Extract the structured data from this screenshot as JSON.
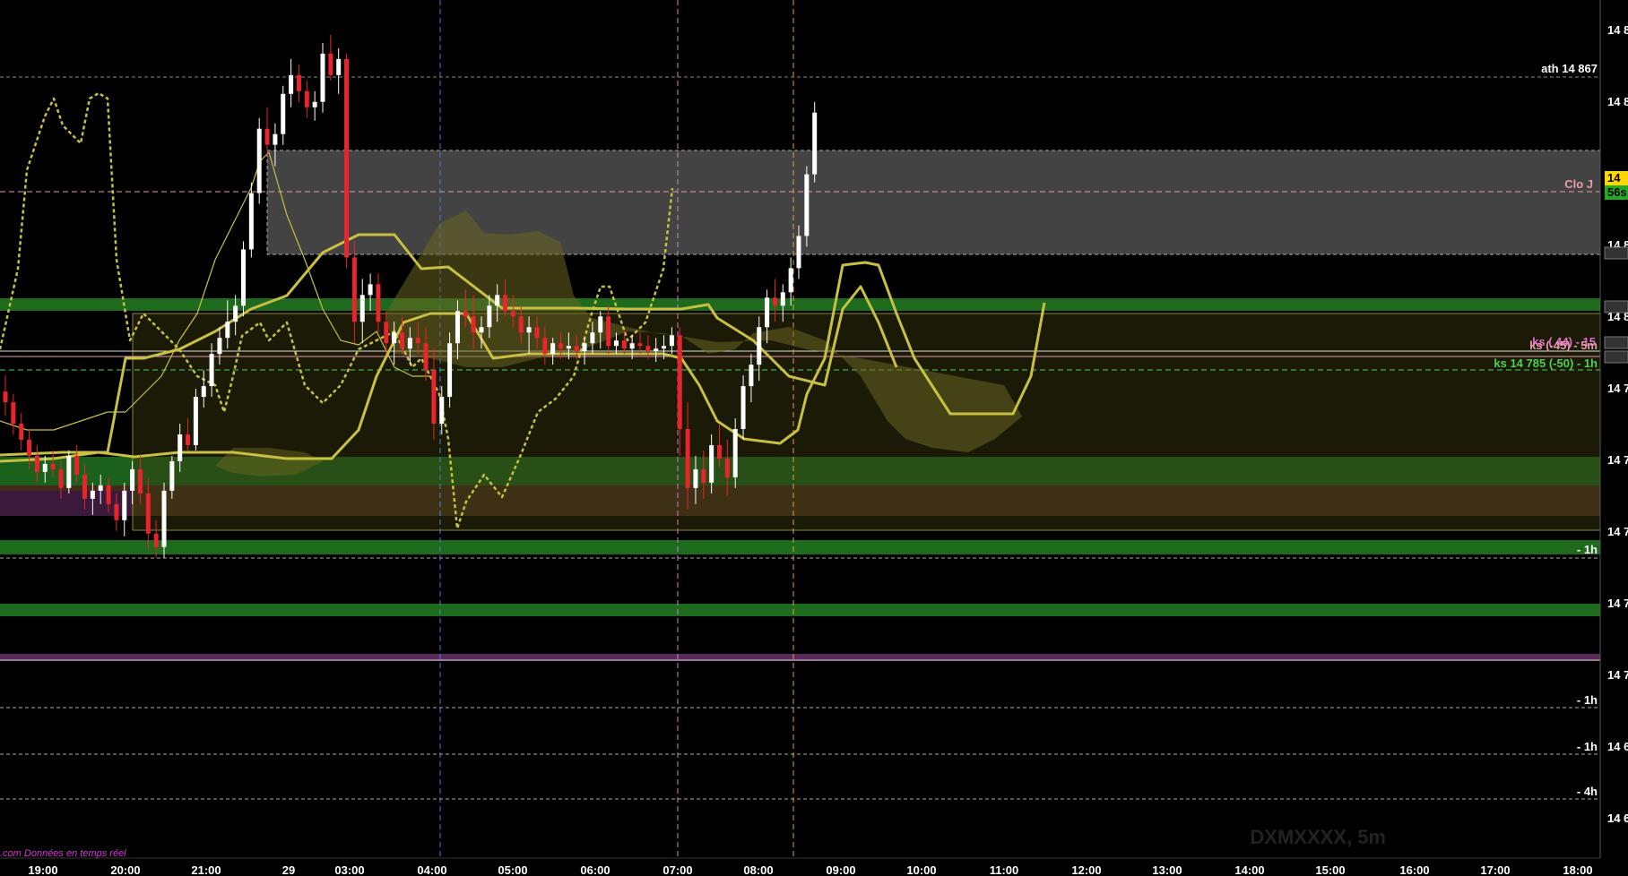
{
  "chart_data": {
    "type": "candlestick",
    "symbol_watermark": "DXMXXXX, 5m",
    "footer_text": ".com Données en temps réel",
    "x_tick_labels": [
      "19:00",
      "20:00",
      "21:00",
      "29",
      "03:00",
      "04:00",
      "05:00",
      "06:00",
      "07:00",
      "08:00",
      "09:00",
      "10:00",
      "11:00",
      "12:00",
      "13:00",
      "14:00",
      "15:00",
      "16:00",
      "17:00",
      "18:00"
    ],
    "y_tick_labels": [
      "14 8",
      "14 8",
      "14 8",
      "14 8",
      "14 7",
      "14 7",
      "14 7",
      "14 7",
      "14 7",
      "14 6",
      "14 6",
      "14 6"
    ],
    "price_badges": [
      {
        "text": "14",
        "color": "#ffd700"
      },
      {
        "text": "56s",
        "color": "#22aa22"
      }
    ],
    "level_annotations": [
      {
        "text": "ath 14 867",
        "color": "#ffffff"
      },
      {
        "text": "Clo J",
        "color": "#e89aa8"
      },
      {
        "text": "ks ( 44) - 15",
        "color": "#e36bd2"
      },
      {
        "text": "ks (-45) - 5m",
        "color": "#e89aa8"
      },
      {
        "text": "ks 14 785 (-50) - 1h",
        "color": "#4fd14f"
      },
      {
        "text": "- 1h",
        "color": "#ffffff"
      },
      {
        "text": "- 1h",
        "color": "#ffffff"
      },
      {
        "text": "- 1h",
        "color": "#ffffff"
      },
      {
        "text": "- 4h",
        "color": "#ffffff"
      }
    ],
    "colors": {
      "background": "#000000",
      "bull_candle": "#ffffff",
      "bear_candle": "#e8242c",
      "ichimoku_line": "#c8c043",
      "cloud_fill": "#6a6620",
      "zone_green": "#1e6b1e",
      "zone_gray": "#5a5a5a",
      "zone_brown": "#4a2d1c"
    },
    "candles": [
      [
        14734,
        14740,
        14725,
        14730
      ],
      [
        14730,
        14733,
        14718,
        14722
      ],
      [
        14722,
        14726,
        14712,
        14716
      ],
      [
        14716,
        14720,
        14705,
        14710
      ],
      [
        14710,
        14714,
        14700,
        14704
      ],
      [
        14704,
        14710,
        14700,
        14707
      ],
      [
        14707,
        14712,
        14702,
        14705
      ],
      [
        14705,
        14708,
        14694,
        14698
      ],
      [
        14698,
        14712,
        14696,
        14710
      ],
      [
        14710,
        14714,
        14700,
        14703
      ],
      [
        14703,
        14707,
        14690,
        14694
      ],
      [
        14694,
        14700,
        14688,
        14697
      ],
      [
        14697,
        14703,
        14692,
        14699
      ],
      [
        14699,
        14702,
        14689,
        14692
      ],
      [
        14692,
        14696,
        14682,
        14686
      ],
      [
        14686,
        14700,
        14680,
        14697
      ],
      [
        14697,
        14708,
        14692,
        14705
      ],
      [
        14705,
        14710,
        14692,
        14696
      ],
      [
        14696,
        14702,
        14675,
        14681
      ],
      [
        14681,
        14686,
        14672,
        14676
      ],
      [
        14676,
        14700,
        14672,
        14697
      ],
      [
        14697,
        14710,
        14694,
        14708
      ],
      [
        14708,
        14722,
        14704,
        14718
      ],
      [
        14718,
        14724,
        14712,
        14714
      ],
      [
        14714,
        14735,
        14712,
        14732
      ],
      [
        14732,
        14742,
        14728,
        14736
      ],
      [
        14736,
        14752,
        14732,
        14748
      ],
      [
        14748,
        14758,
        14744,
        14754
      ],
      [
        14754,
        14768,
        14750,
        14760
      ],
      [
        14760,
        14770,
        14755,
        14766
      ],
      [
        14766,
        14790,
        14762,
        14787
      ],
      [
        14787,
        14812,
        14784,
        14808
      ],
      [
        14808,
        14836,
        14804,
        14832
      ],
      [
        14832,
        14840,
        14822,
        14826
      ],
      [
        14826,
        14834,
        14818,
        14830
      ],
      [
        14830,
        14848,
        14826,
        14845
      ],
      [
        14845,
        14858,
        14840,
        14852
      ],
      [
        14852,
        14856,
        14842,
        14846
      ],
      [
        14846,
        14850,
        14836,
        14840
      ],
      [
        14840,
        14846,
        14835,
        14842
      ],
      [
        14842,
        14864,
        14838,
        14860
      ],
      [
        14860,
        14867,
        14850,
        14852
      ],
      [
        14852,
        14862,
        14845,
        14858
      ],
      [
        14858,
        14860,
        14780,
        14784
      ],
      [
        14784,
        14790,
        14752,
        14760
      ],
      [
        14760,
        14776,
        14752,
        14770
      ],
      [
        14770,
        14778,
        14764,
        14774
      ],
      [
        14774,
        14778,
        14756,
        14760
      ],
      [
        14760,
        14764,
        14748,
        14752
      ],
      [
        14752,
        14760,
        14744,
        14756
      ],
      [
        14756,
        14762,
        14748,
        14750
      ],
      [
        14750,
        14758,
        14744,
        14754
      ],
      [
        14754,
        14760,
        14748,
        14752
      ],
      [
        14752,
        14758,
        14738,
        14742
      ],
      [
        14742,
        14750,
        14716,
        14722
      ],
      [
        14722,
        14736,
        14718,
        14732
      ],
      [
        14732,
        14756,
        14728,
        14752
      ],
      [
        14752,
        14768,
        14746,
        14764
      ],
      [
        14764,
        14772,
        14758,
        14762
      ],
      [
        14762,
        14770,
        14750,
        14756
      ],
      [
        14756,
        14762,
        14750,
        14758
      ],
      [
        14758,
        14770,
        14754,
        14766
      ],
      [
        14766,
        14774,
        14760,
        14770
      ],
      [
        14770,
        14776,
        14762,
        14764
      ],
      [
        14764,
        14770,
        14758,
        14762
      ],
      [
        14762,
        14766,
        14752,
        14756
      ],
      [
        14756,
        14762,
        14748,
        14758
      ],
      [
        14758,
        14762,
        14750,
        14754
      ],
      [
        14754,
        14758,
        14744,
        14748
      ],
      [
        14748,
        14754,
        14744,
        14752
      ],
      [
        14752,
        14756,
        14746,
        14750
      ],
      [
        14750,
        14756,
        14746,
        14751
      ],
      [
        14751,
        14755,
        14746,
        14749
      ],
      [
        14749,
        14754,
        14744,
        14752
      ],
      [
        14752,
        14760,
        14748,
        14756
      ],
      [
        14756,
        14764,
        14750,
        14762
      ],
      [
        14762,
        14766,
        14748,
        14751
      ],
      [
        14751,
        14756,
        14748,
        14753
      ],
      [
        14753,
        14757,
        14748,
        14750
      ],
      [
        14750,
        14755,
        14746,
        14752
      ],
      [
        14752,
        14756,
        14748,
        14751
      ],
      [
        14751,
        14755,
        14746,
        14749
      ],
      [
        14749,
        14754,
        14745,
        14750
      ],
      [
        14750,
        14755,
        14746,
        14751
      ],
      [
        14751,
        14758,
        14748,
        14755
      ],
      [
        14755,
        14758,
        14710,
        14720
      ],
      [
        14720,
        14730,
        14690,
        14698
      ],
      [
        14698,
        14710,
        14692,
        14705
      ],
      [
        14705,
        14712,
        14694,
        14700
      ],
      [
        14700,
        14718,
        14696,
        14714
      ],
      [
        14714,
        14722,
        14706,
        14709
      ],
      [
        14709,
        14716,
        14695,
        14702
      ],
      [
        14702,
        14724,
        14698,
        14720
      ],
      [
        14720,
        14740,
        14716,
        14736
      ],
      [
        14736,
        14748,
        14730,
        14744
      ],
      [
        14744,
        14762,
        14738,
        14758
      ],
      [
        14758,
        14772,
        14752,
        14769
      ],
      [
        14769,
        14776,
        14760,
        14766
      ],
      [
        14766,
        14774,
        14760,
        14771
      ],
      [
        14771,
        14784,
        14766,
        14780
      ],
      [
        14780,
        14796,
        14776,
        14792
      ],
      [
        14792,
        14818,
        14788,
        14815
      ],
      [
        14815,
        14842,
        14812,
        14838
      ]
    ]
  }
}
